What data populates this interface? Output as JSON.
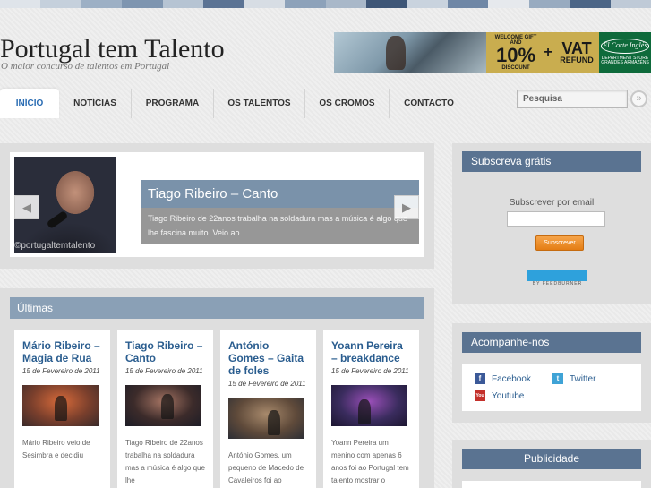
{
  "colors": {
    "topstrip": [
      "#dfe4ea",
      "#c5d0dc",
      "#9db0c5",
      "#7e95b0",
      "#b6c4d3",
      "#5b7394",
      "#d7dde4",
      "#8da2ba",
      "#a9b8c9",
      "#3e5677",
      "#c9d3de",
      "#6f87a6",
      "#e6e9ed",
      "#98abc0",
      "#4b6586",
      "#bfcad7"
    ],
    "accent": "#2a6cb3",
    "title_bar": "#5a7391"
  },
  "site": {
    "title": "Portugal tem Talento",
    "subtitle": "O maior concurso de talentos em Portugal"
  },
  "ad": {
    "gift_line1": "WELCOME GIFT",
    "gift_line2": "AND",
    "discount": "10%",
    "discount_label": "DISCOUNT",
    "plus": "+",
    "vat": "VAT",
    "refund": "REFUND",
    "brand": "El Corte Inglés",
    "brand_sub": "DEPARTMENT STORE GRANDES ARMAZÉNS"
  },
  "nav": {
    "items": [
      {
        "label": "INÍCIO"
      },
      {
        "label": "NOTÍCIAS"
      },
      {
        "label": "PROGRAMA"
      },
      {
        "label": "OS TALENTOS"
      },
      {
        "label": "OS CROMOS"
      },
      {
        "label": "CONTACTO"
      }
    ],
    "search_value": "Pesquisa",
    "search_button": "»"
  },
  "featured": {
    "title": "Tiago Ribeiro – Canto",
    "excerpt": "Tiago Ribeiro de 22anos trabalha na soldadura mas a música é algo que lhe fascina muito. Veio ao...",
    "watermark": "©portugaltemtalento",
    "prev": "◀",
    "next": "▶"
  },
  "latest": {
    "heading": "Últimas",
    "posts": [
      {
        "title": "Mário Ribeiro – Magia de Rua",
        "date": "15 de Fevereiro de 2011",
        "excerpt": "Mário Ribeiro veio de Sesimbra e decidiu",
        "thumb_colors": [
          "#7a3f2c",
          "#d76a3a",
          "#3a2a2a"
        ]
      },
      {
        "title": "Tiago Ribeiro – Canto",
        "date": "15 de Fevereiro de 2011",
        "excerpt": "Tiago Ribeiro de 22anos trabalha na soldadura mas a música é algo que lhe",
        "thumb_colors": [
          "#3c2b2a",
          "#a57463",
          "#1d1d27"
        ]
      },
      {
        "title": "António Gomes – Gaita de foles",
        "date": "15 de Fevereiro de 2011",
        "excerpt": "António Gomes, um pequeno de Macedo de Cavaleiros foi ao",
        "thumb_colors": [
          "#5f4a3a",
          "#a88a6c",
          "#2c2e35"
        ]
      },
      {
        "title": "Yoann Pereira – breakdance",
        "date": "15 de Fevereiro de 2011",
        "excerpt": "Yoann Pereira um menino com apenas 6 anos foi ao Portugal tem talento mostrar o",
        "thumb_colors": [
          "#3a2c5e",
          "#9a4fb8",
          "#1c1630"
        ]
      }
    ]
  },
  "sidebar": {
    "subscribe": {
      "heading": "Subscreva grátis",
      "label": "Subscrever por email",
      "button": "Subscrever",
      "feedburner": "BY FEEDBURNER"
    },
    "follow": {
      "heading": "Acompanhe-nos",
      "links": [
        {
          "label": "Facebook",
          "icon": "facebook-icon",
          "glyph": "f",
          "color": "#3b5998"
        },
        {
          "label": "Twitter",
          "icon": "twitter-icon",
          "glyph": "t",
          "color": "#3fa3d6"
        },
        {
          "label": "Youtube",
          "icon": "youtube-icon",
          "glyph": "You",
          "color": "#c4302b"
        }
      ]
    },
    "ads": {
      "heading": "Publicidade"
    }
  }
}
